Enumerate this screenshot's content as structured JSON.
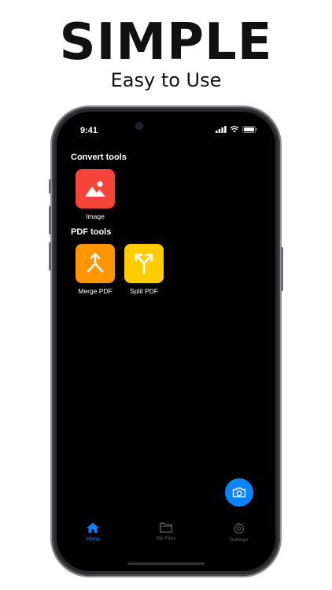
{
  "promo": {
    "headline": "SIMPLE",
    "subline": "Easy to Use"
  },
  "status_bar": {
    "time": "9:41",
    "icons": [
      "cellular-signal-icon",
      "wifi-icon",
      "battery-icon"
    ]
  },
  "sections": {
    "convert": {
      "title": "Convert tools",
      "tools": [
        {
          "label": "Image",
          "icon": "image-icon",
          "color": "#f5443a"
        }
      ]
    },
    "pdf": {
      "title": "PDF tools",
      "tools": [
        {
          "label": "Merge PDF",
          "icon": "merge-arrows-icon",
          "color": "#ff9500"
        },
        {
          "label": "Split PDF",
          "icon": "split-arrows-icon",
          "color": "#ffcc00"
        }
      ]
    }
  },
  "fab": {
    "icon": "camera-icon",
    "color": "#0a84ff"
  },
  "tabbar": {
    "active_color": "#0a84ff",
    "inactive_color": "#5e5e63",
    "tabs": [
      {
        "label": "Home",
        "icon": "home-icon",
        "active": true
      },
      {
        "label": "My Files",
        "icon": "folder-icon",
        "active": false
      },
      {
        "label": "Settings",
        "icon": "gear-icon",
        "active": false
      }
    ]
  }
}
